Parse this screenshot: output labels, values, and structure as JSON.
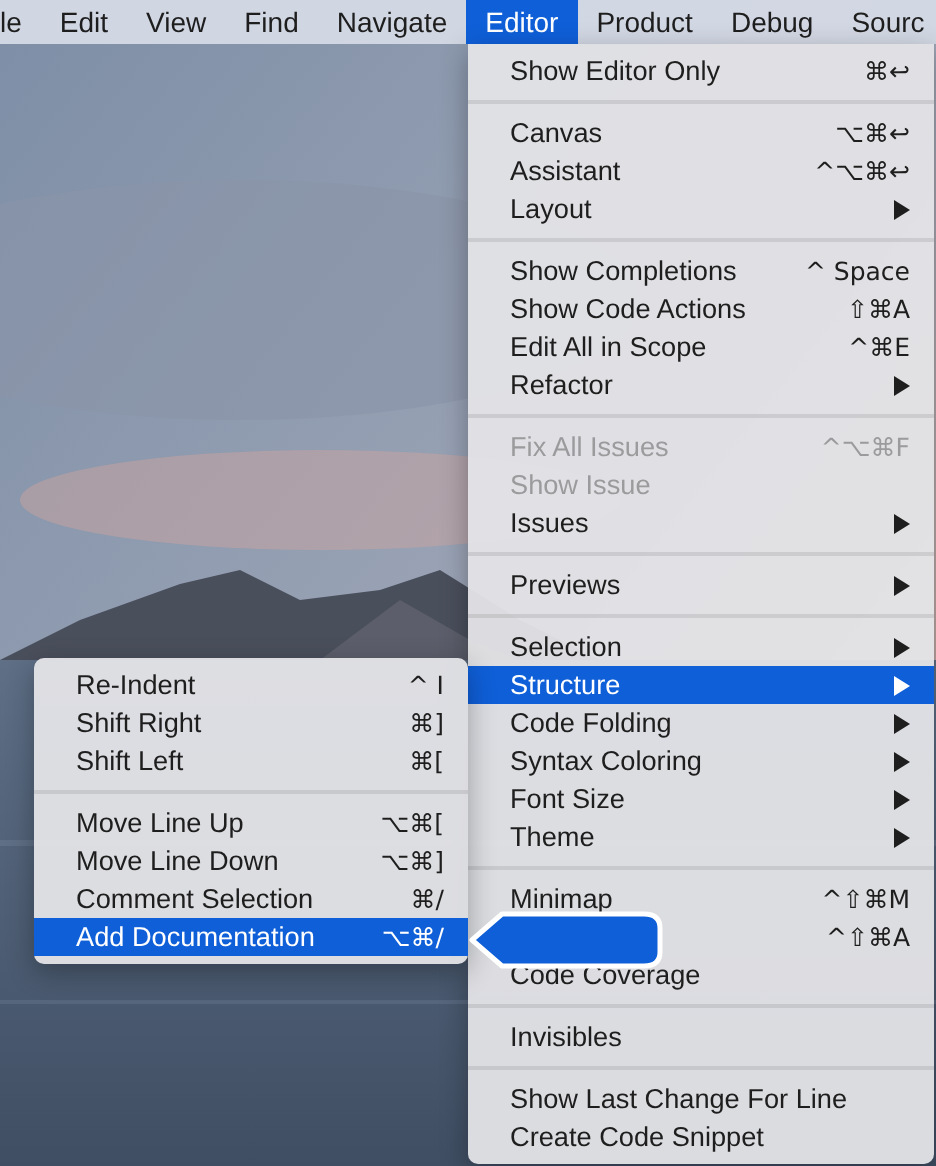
{
  "menubar": [
    {
      "label": "le",
      "selected": false
    },
    {
      "label": "Edit",
      "selected": false
    },
    {
      "label": "View",
      "selected": false
    },
    {
      "label": "Find",
      "selected": false
    },
    {
      "label": "Navigate",
      "selected": false
    },
    {
      "label": "Editor",
      "selected": true
    },
    {
      "label": "Product",
      "selected": false
    },
    {
      "label": "Debug",
      "selected": false
    },
    {
      "label": "Sourc",
      "selected": false
    }
  ],
  "editor_menu": {
    "sections": [
      [
        {
          "label": "Show Editor Only",
          "shortcut": "⌘↩",
          "has_submenu": false,
          "disabled": false,
          "selected": false
        }
      ],
      [
        {
          "label": "Canvas",
          "shortcut": "⌥⌘↩",
          "has_submenu": false,
          "disabled": false,
          "selected": false
        },
        {
          "label": "Assistant",
          "shortcut": "^⌥⌘↩",
          "has_submenu": false,
          "disabled": false,
          "selected": false
        },
        {
          "label": "Layout",
          "has_submenu": true,
          "disabled": false,
          "selected": false
        }
      ],
      [
        {
          "label": "Show Completions",
          "shortcut": "^ Space",
          "has_submenu": false,
          "disabled": false,
          "selected": false
        },
        {
          "label": "Show Code Actions",
          "shortcut": "⇧⌘A",
          "has_submenu": false,
          "disabled": false,
          "selected": false
        },
        {
          "label": "Edit All in Scope",
          "shortcut": "^⌘E",
          "has_submenu": false,
          "disabled": false,
          "selected": false
        },
        {
          "label": "Refactor",
          "has_submenu": true,
          "disabled": false,
          "selected": false
        }
      ],
      [
        {
          "label": "Fix All Issues",
          "shortcut": "^⌥⌘F",
          "has_submenu": false,
          "disabled": true,
          "selected": false
        },
        {
          "label": "Show Issue",
          "has_submenu": false,
          "disabled": true,
          "selected": false
        },
        {
          "label": "Issues",
          "has_submenu": true,
          "disabled": false,
          "selected": false
        }
      ],
      [
        {
          "label": "Previews",
          "has_submenu": true,
          "disabled": false,
          "selected": false
        }
      ],
      [
        {
          "label": "Selection",
          "has_submenu": true,
          "disabled": false,
          "selected": false
        },
        {
          "label": "Structure",
          "has_submenu": true,
          "disabled": false,
          "selected": true
        },
        {
          "label": "Code Folding",
          "has_submenu": true,
          "disabled": false,
          "selected": false
        },
        {
          "label": "Syntax Coloring",
          "has_submenu": true,
          "disabled": false,
          "selected": false
        },
        {
          "label": "Font Size",
          "has_submenu": true,
          "disabled": false,
          "selected": false
        },
        {
          "label": "Theme",
          "has_submenu": true,
          "disabled": false,
          "selected": false
        }
      ],
      [
        {
          "label": "Minimap",
          "shortcut": "^⇧⌘M",
          "has_submenu": false,
          "disabled": false,
          "selected": false
        },
        {
          "shortcut": "^⇧⌘A",
          "has_submenu": false,
          "disabled": false,
          "selected": false
        },
        {
          "label": "Code Coverage",
          "has_submenu": false,
          "disabled": false,
          "selected": false
        }
      ],
      [
        {
          "label": "Invisibles",
          "has_submenu": false,
          "disabled": false,
          "selected": false
        }
      ],
      [
        {
          "label": "Show Last Change For Line",
          "has_submenu": false,
          "disabled": false,
          "selected": false
        },
        {
          "label": "Create Code Snippet",
          "has_submenu": false,
          "disabled": false,
          "selected": false
        }
      ]
    ]
  },
  "structure_submenu": {
    "sections": [
      [
        {
          "label": "Re-Indent",
          "shortcut": "^ I",
          "has_submenu": false,
          "disabled": false,
          "selected": false
        },
        {
          "label": "Shift Right",
          "shortcut": "⌘]",
          "has_submenu": false,
          "disabled": false,
          "selected": false
        },
        {
          "label": "Shift Left",
          "shortcut": "⌘[",
          "has_submenu": false,
          "disabled": false,
          "selected": false
        }
      ],
      [
        {
          "label": "Move Line Up",
          "shortcut": "⌥⌘[",
          "has_submenu": false,
          "disabled": false,
          "selected": false
        },
        {
          "label": "Move Line Down",
          "shortcut": "⌥⌘]",
          "has_submenu": false,
          "disabled": false,
          "selected": false
        },
        {
          "label": "Comment Selection",
          "shortcut": "⌘/",
          "has_submenu": false,
          "disabled": false,
          "selected": false
        },
        {
          "label": "Add Documentation",
          "shortcut": "⌥⌘/",
          "has_submenu": false,
          "disabled": false,
          "selected": true
        }
      ]
    ]
  }
}
